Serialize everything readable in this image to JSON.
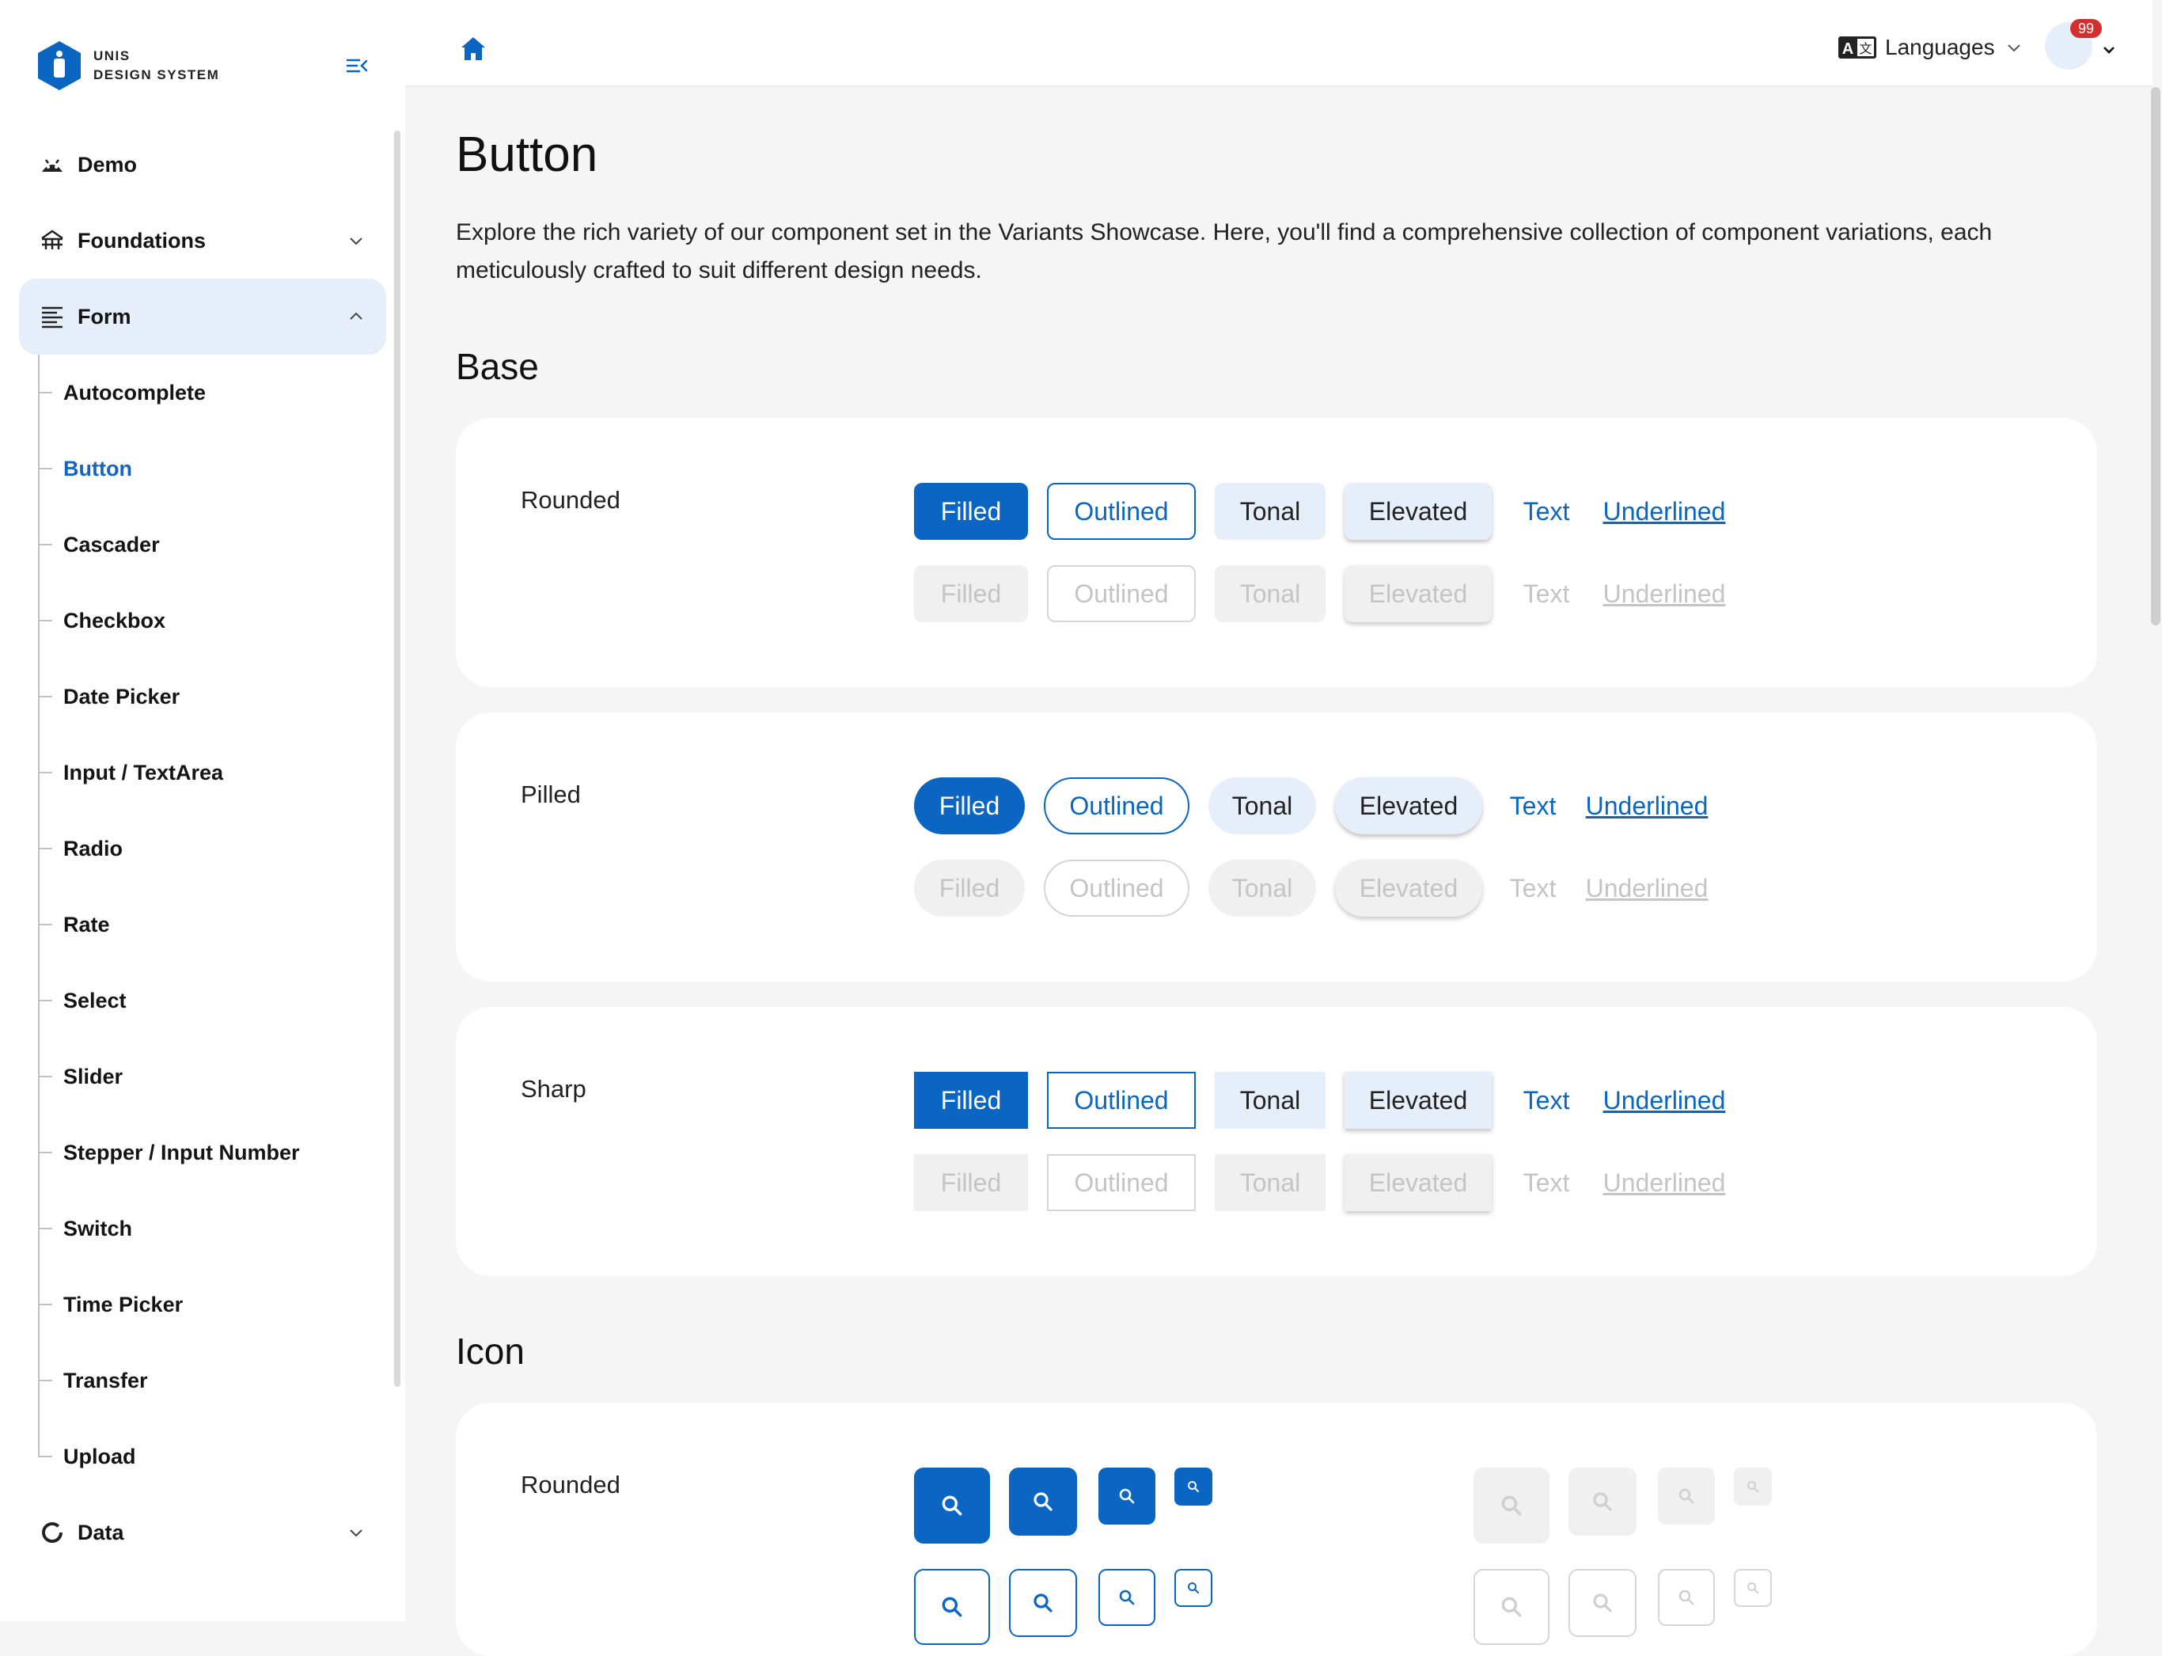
{
  "brand": {
    "line1": "UNIS",
    "line2": "DESIGN SYSTEM"
  },
  "sidebar": {
    "items": [
      {
        "label": "Demo",
        "icon": "android-icon"
      },
      {
        "label": "Foundations",
        "icon": "temple-icon"
      },
      {
        "label": "Form",
        "icon": "form-lines-icon",
        "expanded": true
      },
      {
        "label": "Data",
        "icon": "donut-icon"
      }
    ],
    "form_children": [
      "Autocomplete",
      "Button",
      "Cascader",
      "Checkbox",
      "Date Picker",
      "Input / TextArea",
      "Radio",
      "Rate",
      "Select",
      "Slider",
      "Stepper / Input Number",
      "Switch",
      "Time Picker",
      "Transfer",
      "Upload"
    ],
    "selected": "Button"
  },
  "header": {
    "languages_label": "Languages",
    "notification_count": "99"
  },
  "main": {
    "title": "Button",
    "intro": "Explore the rich variety of our component set in the Variants Showcase. Here, you'll find a comprehensive collection of component variations, each meticulously crafted to suit different design needs.",
    "sections": {
      "base": {
        "title": "Base",
        "rows": [
          "Rounded",
          "Pilled",
          "Sharp"
        ],
        "buttons": [
          "Filled",
          "Outlined",
          "Tonal",
          "Elevated",
          "Text",
          "Underlined"
        ]
      },
      "icon": {
        "title": "Icon",
        "rows": [
          "Rounded"
        ],
        "icon": "search-icon"
      }
    }
  },
  "colors": {
    "primary": "#0a66c2",
    "tonal": "#e6eff9",
    "selected_text": "#1565c0",
    "badge": "#d32f2f",
    "disabled_text": "#c4c4c4"
  }
}
